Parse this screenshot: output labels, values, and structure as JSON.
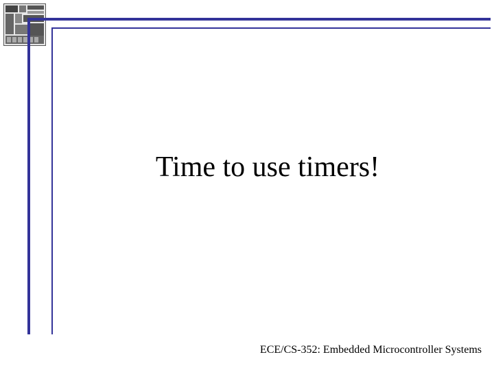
{
  "slide": {
    "title": "Time to use timers!",
    "footer": "ECE/CS-352: Embedded Microcontroller Systems"
  },
  "theme": {
    "rule_color": "#333399"
  }
}
